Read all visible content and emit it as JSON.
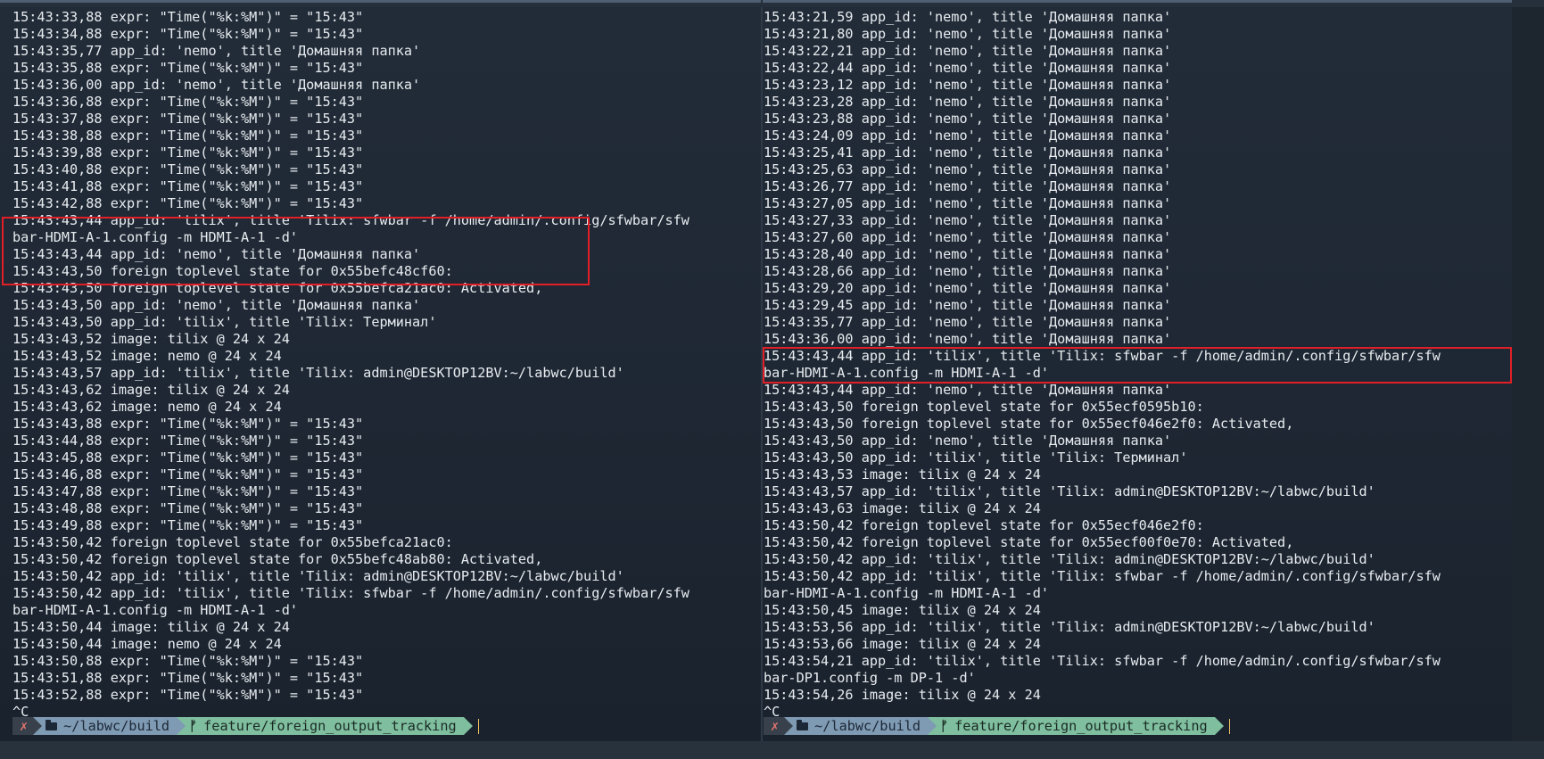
{
  "left_pane": {
    "lines": [
      "15:43:33,88 expr: \"Time(\"%k:%M\")\" = \"15:43\"",
      "15:43:34,88 expr: \"Time(\"%k:%M\")\" = \"15:43\"",
      "15:43:35,77 app_id: 'nemo', title 'Домашняя папка'",
      "15:43:35,88 expr: \"Time(\"%k:%M\")\" = \"15:43\"",
      "15:43:36,00 app_id: 'nemo', title 'Домашняя папка'",
      "15:43:36,88 expr: \"Time(\"%k:%M\")\" = \"15:43\"",
      "15:43:37,88 expr: \"Time(\"%k:%M\")\" = \"15:43\"",
      "15:43:38,88 expr: \"Time(\"%k:%M\")\" = \"15:43\"",
      "15:43:39,88 expr: \"Time(\"%k:%M\")\" = \"15:43\"",
      "15:43:40,88 expr: \"Time(\"%k:%M\")\" = \"15:43\"",
      "15:43:41,88 expr: \"Time(\"%k:%M\")\" = \"15:43\"",
      "15:43:42,88 expr: \"Time(\"%k:%M\")\" = \"15:43\"",
      "15:43:43,44 app_id: 'tilix', title 'Tilix: sfwbar -f /home/admin/.config/sfwbar/sfw",
      "bar-HDMI-A-1.config -m HDMI-A-1 -d'",
      "15:43:43,44 app_id: 'nemo', title 'Домашняя папка'",
      "15:43:43,50 foreign toplevel state for 0x55befc48cf60:",
      "15:43:43,50 foreign toplevel state for 0x55befca21ac0: Activated,",
      "15:43:43,50 app_id: 'nemo', title 'Домашняя папка'",
      "15:43:43,50 app_id: 'tilix', title 'Tilix: Терминал'",
      "15:43:43,52 image: tilix @ 24 x 24",
      "15:43:43,52 image: nemo @ 24 x 24",
      "15:43:43,57 app_id: 'tilix', title 'Tilix: admin@DESKTOP12BV:~/labwc/build'",
      "15:43:43,62 image: tilix @ 24 x 24",
      "15:43:43,62 image: nemo @ 24 x 24",
      "15:43:43,88 expr: \"Time(\"%k:%M\")\" = \"15:43\"",
      "15:43:44,88 expr: \"Time(\"%k:%M\")\" = \"15:43\"",
      "15:43:45,88 expr: \"Time(\"%k:%M\")\" = \"15:43\"",
      "15:43:46,88 expr: \"Time(\"%k:%M\")\" = \"15:43\"",
      "15:43:47,88 expr: \"Time(\"%k:%M\")\" = \"15:43\"",
      "15:43:48,88 expr: \"Time(\"%k:%M\")\" = \"15:43\"",
      "15:43:49,88 expr: \"Time(\"%k:%M\")\" = \"15:43\"",
      "15:43:50,42 foreign toplevel state for 0x55befca21ac0:",
      "15:43:50,42 foreign toplevel state for 0x55befc48ab80: Activated,",
      "15:43:50,42 app_id: 'tilix', title 'Tilix: admin@DESKTOP12BV:~/labwc/build'",
      "15:43:50,42 app_id: 'tilix', title 'Tilix: sfwbar -f /home/admin/.config/sfwbar/sfw",
      "bar-HDMI-A-1.config -m HDMI-A-1 -d'",
      "15:43:50,44 image: tilix @ 24 x 24",
      "15:43:50,44 image: nemo @ 24 x 24",
      "15:43:50,88 expr: \"Time(\"%k:%M\")\" = \"15:43\"",
      "15:43:51,88 expr: \"Time(\"%k:%M\")\" = \"15:43\"",
      "15:43:52,88 expr: \"Time(\"%k:%M\")\" = \"15:43\"",
      "^C"
    ],
    "prompt": {
      "status": "✗",
      "directory": "~/labwc/build",
      "branch_glyph": "ᚠ",
      "branch": "feature/foreign_output_tracking"
    }
  },
  "right_pane": {
    "lines": [
      "15:43:21,59 app_id: 'nemo', title 'Домашняя папка'",
      "15:43:21,80 app_id: 'nemo', title 'Домашняя папка'",
      "15:43:22,21 app_id: 'nemo', title 'Домашняя папка'",
      "15:43:22,44 app_id: 'nemo', title 'Домашняя папка'",
      "15:43:23,12 app_id: 'nemo', title 'Домашняя папка'",
      "15:43:23,28 app_id: 'nemo', title 'Домашняя папка'",
      "15:43:23,88 app_id: 'nemo', title 'Домашняя папка'",
      "15:43:24,09 app_id: 'nemo', title 'Домашняя папка'",
      "15:43:25,41 app_id: 'nemo', title 'Домашняя папка'",
      "15:43:25,63 app_id: 'nemo', title 'Домашняя папка'",
      "15:43:26,77 app_id: 'nemo', title 'Домашняя папка'",
      "15:43:27,05 app_id: 'nemo', title 'Домашняя папка'",
      "15:43:27,33 app_id: 'nemo', title 'Домашняя папка'",
      "15:43:27,60 app_id: 'nemo', title 'Домашняя папка'",
      "15:43:28,40 app_id: 'nemo', title 'Домашняя папка'",
      "15:43:28,66 app_id: 'nemo', title 'Домашняя папка'",
      "15:43:29,20 app_id: 'nemo', title 'Домашняя папка'",
      "15:43:29,45 app_id: 'nemo', title 'Домашняя папка'",
      "15:43:35,77 app_id: 'nemo', title 'Домашняя папка'",
      "15:43:36,00 app_id: 'nemo', title 'Домашняя папка'",
      "15:43:43,44 app_id: 'tilix', title 'Tilix: sfwbar -f /home/admin/.config/sfwbar/sfw",
      "bar-HDMI-A-1.config -m HDMI-A-1 -d'",
      "15:43:43,44 app_id: 'nemo', title 'Домашняя папка'",
      "15:43:43,50 foreign toplevel state for 0x55ecf0595b10:",
      "15:43:43,50 foreign toplevel state for 0x55ecf046e2f0: Activated,",
      "15:43:43,50 app_id: 'nemo', title 'Домашняя папка'",
      "15:43:43,50 app_id: 'tilix', title 'Tilix: Терминал'",
      "15:43:43,53 image: tilix @ 24 x 24",
      "15:43:43,57 app_id: 'tilix', title 'Tilix: admin@DESKTOP12BV:~/labwc/build'",
      "15:43:43,63 image: tilix @ 24 x 24",
      "15:43:50,42 foreign toplevel state for 0x55ecf046e2f0:",
      "15:43:50,42 foreign toplevel state for 0x55ecf00f0e70: Activated,",
      "15:43:50,42 app_id: 'tilix', title 'Tilix: admin@DESKTOP12BV:~/labwc/build'",
      "15:43:50,42 app_id: 'tilix', title 'Tilix: sfwbar -f /home/admin/.config/sfwbar/sfw",
      "bar-HDMI-A-1.config -m HDMI-A-1 -d'",
      "15:43:50,45 image: tilix @ 24 x 24",
      "15:43:53,56 app_id: 'tilix', title 'Tilix: admin@DESKTOP12BV:~/labwc/build'",
      "15:43:53,66 image: tilix @ 24 x 24",
      "15:43:54,21 app_id: 'tilix', title 'Tilix: sfwbar -f /home/admin/.config/sfwbar/sfw",
      "bar-DP1.config -m DP-1 -d'",
      "15:43:54,26 image: tilix @ 24 x 24",
      "^C"
    ],
    "prompt": {
      "status": "✗",
      "directory": "~/labwc/build",
      "branch_glyph": "ᚠ",
      "branch": "feature/foreign_output_tracking"
    }
  },
  "colors": {
    "highlight_box": "#e21f26",
    "prompt_status_bg": "#37404b",
    "prompt_dir_bg": "#7f9ab3",
    "prompt_branch_bg": "#7fbf9f",
    "cursor": "#f0c060"
  },
  "icons": {
    "directory": "folder-icon",
    "branch": "git-branch-icon",
    "status": "error-x-icon"
  }
}
